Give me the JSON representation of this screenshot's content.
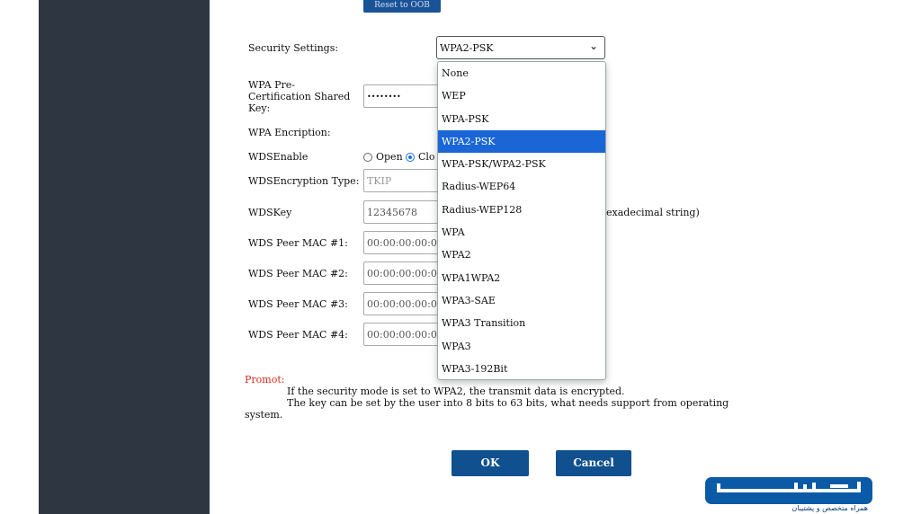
{
  "top_button": "Reset to OOB",
  "security": {
    "label": "Security Settings:",
    "selected": "WPA2-PSK",
    "options": [
      "None",
      "WEP",
      "WPA-PSK",
      "WPA2-PSK",
      "WPA-PSK/WPA2-PSK",
      "Radius-WEP64",
      "Radius-WEP128",
      "WPA",
      "WPA2",
      "WPA1WPA2",
      "WPA3-SAE",
      "WPA3 Transition",
      "WPA3",
      "WPA3-192Bit"
    ]
  },
  "psk": {
    "label_1": "WPA Pre-",
    "label_2": "Certification Shared",
    "label_3": "Key:",
    "value": "••••••••"
  },
  "encryption_label": "WPA Encription:",
  "wds_enable": {
    "label": "WDSEnable",
    "opt1": "Open",
    "opt2": "Clo"
  },
  "wds_enc_type": {
    "label": "WDSEncryption Type:",
    "value": "TKIP"
  },
  "wds_key": {
    "label": "WDSKey",
    "value": "12345678",
    "hint": "exadecimal string)"
  },
  "peers": [
    {
      "label": "WDS Peer MAC #1:",
      "value": "00:00:00:00:00"
    },
    {
      "label": "WDS Peer MAC #2:",
      "value": "00:00:00:00:00"
    },
    {
      "label": "WDS Peer MAC #3:",
      "value": "00:00:00:00:00"
    },
    {
      "label": "WDS Peer MAC #4:",
      "value": "00:00:00:00:00"
    }
  ],
  "prompt": {
    "title": "Promot:",
    "line1": "If the security mode is set to WPA2, the transmit data is encrypted.",
    "line2": "The key can be set by the user into 8 bits to 63 bits, what needs support from operating",
    "line3": "system."
  },
  "buttons": {
    "ok": "OK",
    "cancel": "Cancel"
  },
  "logo": {
    "tagline": "همراه متخصص و پشتیبان"
  }
}
